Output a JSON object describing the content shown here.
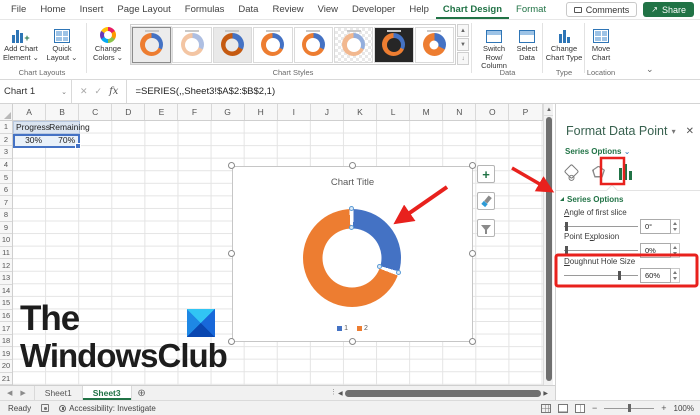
{
  "ribbon_tabs": [
    {
      "label": "File",
      "active": false,
      "contextual": false
    },
    {
      "label": "Home",
      "active": false,
      "contextual": false
    },
    {
      "label": "Insert",
      "active": false,
      "contextual": false
    },
    {
      "label": "Page Layout",
      "active": false,
      "contextual": false
    },
    {
      "label": "Formulas",
      "active": false,
      "contextual": false
    },
    {
      "label": "Data",
      "active": false,
      "contextual": false
    },
    {
      "label": "Review",
      "active": false,
      "contextual": false
    },
    {
      "label": "View",
      "active": false,
      "contextual": false
    },
    {
      "label": "Developer",
      "active": false,
      "contextual": false
    },
    {
      "label": "Help",
      "active": false,
      "contextual": false
    },
    {
      "label": "Chart Design",
      "active": true,
      "contextual": true
    },
    {
      "label": "Format",
      "active": false,
      "contextual": true
    }
  ],
  "top_right": {
    "comments_label": "Comments",
    "share_label": "Share"
  },
  "ribbon": {
    "chart_layouts": {
      "group_label": "Chart Layouts",
      "add_chart_element_label": "Add Chart Element",
      "quick_layout_label": "Quick Layout"
    },
    "chart_styles": {
      "group_label": "Chart Styles",
      "change_colors_label": "Change Colors",
      "thumbs": [
        {
          "bg": "#ececec",
          "blue": "#4472c4",
          "orange": "#ed7d31",
          "hole": 0.62,
          "selected": true
        },
        {
          "bg": "#ffffff",
          "blue": "#aebfe2",
          "orange": "#f3c5a3",
          "hole": 0.62,
          "selected": false
        },
        {
          "bg": "#e9e9e9",
          "blue": "#4472c4",
          "orange": "#c55a11",
          "hole": 0.55,
          "selected": false
        },
        {
          "bg": "#ffffff",
          "blue": "#4472c4",
          "orange": "#ed7d31",
          "hole": 0.62,
          "selected": false
        },
        {
          "bg": "#ffffff",
          "blue": "#4472c4",
          "orange": "#ed7d31",
          "hole": 0.62,
          "selected": false
        },
        {
          "bg": "checker",
          "blue": "#93aedd",
          "orange": "#f2b88f",
          "hole": 0.62,
          "selected": false
        },
        {
          "bg": "#262626",
          "blue": "#4472c4",
          "orange": "#ed7d31",
          "hole": 0.62,
          "selected": false
        },
        {
          "bg": "#ffffff",
          "blue": "#4472c4",
          "orange": "#ed7d31",
          "hole": 0.38,
          "selected": false
        }
      ]
    },
    "data_group": {
      "group_label": "Data",
      "switch_line1": "Switch Row/",
      "switch_line2": "Column",
      "select_line1": "Select",
      "select_line2": "Data"
    },
    "type_group": {
      "group_label": "Type",
      "change_line1": "Change",
      "change_line2": "Chart Type"
    },
    "location_group": {
      "group_label": "Location",
      "move_line1": "Move",
      "move_line2": "Chart"
    }
  },
  "formula_bar": {
    "name_box": "Chart 1",
    "formula": "=SERIES(,,Sheet3!$A$2:$B$2,1)"
  },
  "grid": {
    "columns": [
      "A",
      "B",
      "C",
      "D",
      "E",
      "F",
      "G",
      "H",
      "I",
      "J",
      "K",
      "L",
      "M",
      "N",
      "O",
      "P"
    ],
    "row_count": 21,
    "cells": [
      {
        "ref": "A1",
        "text": "Progress",
        "align": "left"
      },
      {
        "ref": "B1",
        "text": "Remaining",
        "align": "left"
      },
      {
        "ref": "A2",
        "text": "30%",
        "align": "right"
      },
      {
        "ref": "B2",
        "text": "70%",
        "align": "right"
      }
    ]
  },
  "chart_data": {
    "type": "doughnut",
    "title": "Chart Title",
    "categories": [
      "1",
      "2"
    ],
    "values": [
      30,
      70
    ],
    "colors": [
      "#4472c4",
      "#ed7d31"
    ],
    "hole_size_pct": 60,
    "legend_position": "bottom"
  },
  "format_pane": {
    "title": "Format Data Point",
    "subtitle": "Series Options",
    "section_header": "Series Options",
    "icons": [
      "fill-bucket-icon",
      "effects-pentagon-icon",
      "series-columns-icon"
    ],
    "fields": [
      {
        "id": "angle-of-first-slice",
        "pre": "",
        "u": "A",
        "post": "ngle of first slice",
        "value": "0°",
        "slider_pct": 2,
        "highlighted": false
      },
      {
        "id": "point-explosion",
        "pre": "Point E",
        "u": "x",
        "post": "plosion",
        "value": "0%",
        "slider_pct": 2,
        "highlighted": false
      },
      {
        "id": "doughnut-hole-size",
        "pre": "",
        "u": "D",
        "post": "oughnut Hole Size",
        "value": "60%",
        "slider_pct": 73,
        "highlighted": true
      }
    ]
  },
  "sheet_bar": {
    "tabs": [
      {
        "label": "Sheet1",
        "active": false
      },
      {
        "label": "Sheet3",
        "active": true
      }
    ]
  },
  "status_bar": {
    "ready": "Ready",
    "accessibility": "Accessibility: Investigate",
    "zoom": "100%"
  },
  "watermark": {
    "line1": "The",
    "line2": "WindowsClub"
  },
  "annotation_color": "#e8211d"
}
